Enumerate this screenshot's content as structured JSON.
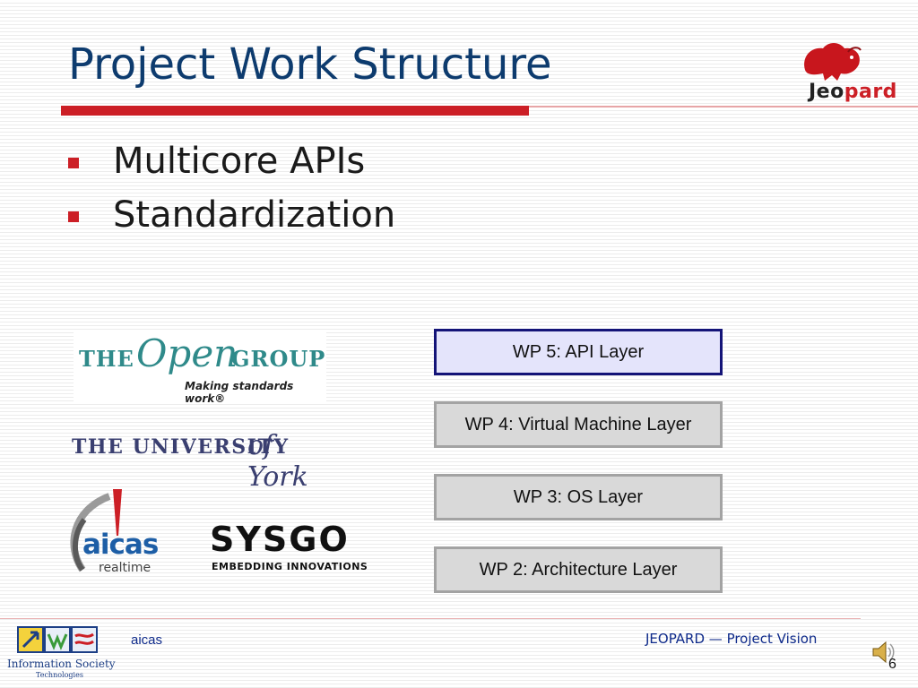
{
  "slide": {
    "title": "Project Work Structure",
    "brand": {
      "logo_icon": "bison-icon",
      "name_part1": "Jeo",
      "name_part2": "pard"
    },
    "bullets": [
      "Multicore APIs",
      "Standardization"
    ],
    "partner_logos": {
      "open_group": {
        "the": "THE",
        "open": "Open",
        "group": "GROUP",
        "tagline": "Making standards work®"
      },
      "york": {
        "main": "THE UNIVERSITY",
        "of_york": "of York"
      },
      "aicas": {
        "name": "aicas",
        "sub": "realtime"
      },
      "sysgo": {
        "name": "SYSGO",
        "sub": "EMBEDDING INNOVATIONS"
      }
    },
    "work_packages": [
      "WP 5: API Layer",
      "WP 4: Virtual Machine Layer",
      "WP 3: OS Layer",
      "WP 2: Architecture Layer"
    ],
    "footer": {
      "ist_logo": {
        "line1": "Information Society",
        "line2": "Technologies"
      },
      "left": "aicas",
      "right": "JEOPARD — Project Vision",
      "page_number": "6",
      "sound_icon": "speaker-icon"
    }
  },
  "colors": {
    "title": "#0d3b6e",
    "accent_red": "#cc1f26",
    "wp_active_fill": "#e4e4fb",
    "wp_active_border": "#141478",
    "wp_fill": "#d9d9d9",
    "wp_border": "#a3a3a3",
    "footer_text": "#0e2a8a"
  }
}
